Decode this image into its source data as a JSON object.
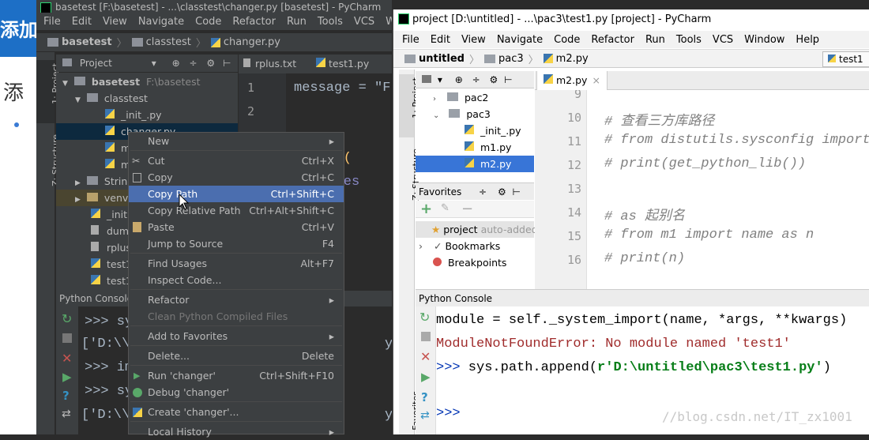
{
  "background": {
    "bg_title_fragment": "添加",
    "bg_text_fragment": "添"
  },
  "left_window": {
    "title": "basetest [F:\\basetest] - ...\\classtest\\changer.py [basetest] - PyCharm",
    "menu": [
      "File",
      "Edit",
      "View",
      "Navigate",
      "Code",
      "Refactor",
      "Run",
      "Tools",
      "VCS",
      "Window"
    ],
    "breadcrumb": [
      "basetest",
      "classtest",
      "changer.py"
    ],
    "project_tool_label": "Project",
    "tabs": [
      "rplus.txt",
      "test1.py"
    ],
    "tree": [
      {
        "label": "basetest",
        "suffix": "F:\\basetest"
      },
      {
        "label": "classtest"
      },
      {
        "label": "_init_.py"
      },
      {
        "label": "changer.py"
      },
      {
        "label": "m"
      },
      {
        "label": "m"
      },
      {
        "label": "String"
      },
      {
        "label": "venv"
      },
      {
        "label": "_init"
      },
      {
        "label": "dump"
      },
      {
        "label": "rplus"
      },
      {
        "label": "test1"
      },
      {
        "label": "test1"
      }
    ],
    "gutter": [
      "1",
      "2"
    ],
    "code_fragments": {
      "line1": "message = \"F",
      "line_nter": "nter(",
      "line_nt": "nt(mes"
    },
    "side_tabs": [
      "1: Project",
      "Z: Structure"
    ],
    "console_label": "Python Console",
    "console_fragments": [
      ">>> sy",
      "['D:\\\\",
      ">>> im",
      ">>> sy",
      "['D:\\\\"
    ],
    "console_right_fragments": [
      "yCharm",
      "yCharm"
    ]
  },
  "context_menu": {
    "items": [
      {
        "label": "New",
        "shortcut": "",
        "submenu": true
      },
      {
        "label": "Cut",
        "shortcut": "Ctrl+X",
        "icon": "scissors-icon"
      },
      {
        "label": "Copy",
        "shortcut": "Ctrl+C",
        "icon": "copy-icon"
      },
      {
        "label": "Copy Path",
        "shortcut": "Ctrl+Shift+C",
        "selected": true
      },
      {
        "label": "Copy Relative Path",
        "shortcut": "Ctrl+Alt+Shift+C"
      },
      {
        "label": "Paste",
        "shortcut": "Ctrl+V",
        "icon": "paste-icon"
      },
      {
        "label": "Jump to Source",
        "shortcut": "F4"
      },
      {
        "label": "Find Usages",
        "shortcut": "Alt+F7"
      },
      {
        "label": "Inspect Code...",
        "shortcut": ""
      },
      {
        "label": "Refactor",
        "shortcut": "",
        "submenu": true
      },
      {
        "label": "Clean Python Compiled Files",
        "shortcut": "",
        "disabled": true
      },
      {
        "label": "Add to Favorites",
        "shortcut": "",
        "submenu": true
      },
      {
        "label": "Delete...",
        "shortcut": "Delete"
      },
      {
        "label": "Run 'changer'",
        "shortcut": "Ctrl+Shift+F10",
        "icon": "run-icon"
      },
      {
        "label": "Debug 'changer'",
        "shortcut": "",
        "icon": "debug-icon"
      },
      {
        "label": "Create 'changer'...",
        "shortcut": "",
        "icon": "python-icon"
      },
      {
        "label": "Local History",
        "shortcut": "",
        "submenu": true
      }
    ]
  },
  "right_window": {
    "title": "project [D:\\untitled] - ...\\pac3\\test1.py [project] - PyCharm",
    "menu": [
      "File",
      "Edit",
      "View",
      "Navigate",
      "Code",
      "Refactor",
      "Run",
      "Tools",
      "VCS",
      "Window",
      "Help"
    ],
    "breadcrumb": [
      "untitled",
      "pac3",
      "m2.py"
    ],
    "run_config": "test1",
    "side_tabs": [
      "1: Project",
      "Z: Structure",
      "Favorites"
    ],
    "tree": [
      {
        "label": "pac2"
      },
      {
        "label": "pac3"
      },
      {
        "label": "_init_.py"
      },
      {
        "label": "m1.py"
      },
      {
        "label": "m2.py",
        "selected": true
      }
    ],
    "favorites_title": "Favorites",
    "favorites": [
      {
        "label": "project",
        "suffix": "auto-added"
      },
      {
        "label": "Bookmarks"
      },
      {
        "label": "Breakpoints"
      }
    ],
    "tab": "m2.py",
    "gutter": [
      "9",
      "10",
      "11",
      "12",
      "13",
      "14",
      "15",
      "16"
    ],
    "code": [
      "",
      "# 查看三方库路径",
      "# from distutils.sysconfig import",
      "# print(get_python_lib())",
      "",
      "# as 起别名",
      "# from m1 import name as n",
      "# print(n)"
    ],
    "console_label": "Python Console",
    "console": {
      "line1": "    module = self._system_import(name, *args, **kwargs)",
      "line2": "ModuleNotFoundError: No module named 'test1'",
      "prompt": ">>>",
      "cmd_pre": " sys.path.append(",
      "cmd_str": "r'D:\\untitled\\pac3\\test1.py'",
      "cmd_post": ")",
      "prompt2": ">>>"
    },
    "watermark": "//blog.csdn.net/IT_zx1001"
  }
}
